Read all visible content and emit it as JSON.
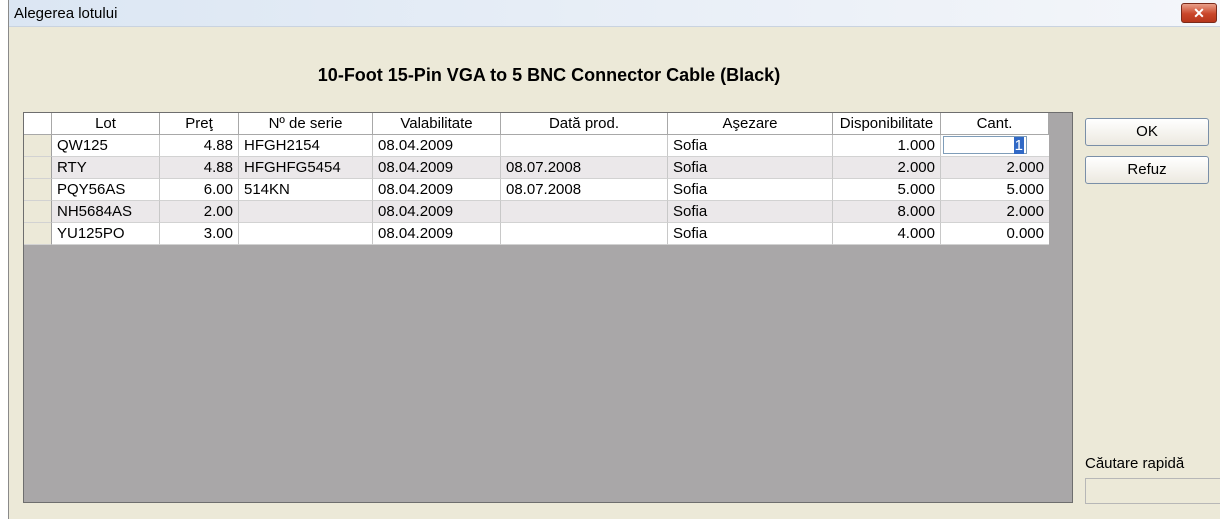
{
  "window": {
    "title": "Alegerea lotului",
    "close_symbol": "✕"
  },
  "product_title": "10-Foot 15-Pin VGA to 5 BNC Connector Cable (Black)",
  "table": {
    "columns": [
      "Lot",
      "Preţ",
      "Nº de serie",
      "Valabilitate",
      "Dată prod.",
      "Aşezare",
      "Disponibilitate",
      "Cant."
    ],
    "rows": [
      {
        "lot": "QW125",
        "pret": "4.88",
        "serie": "HFGH2154",
        "valabilitate": "08.04.2009",
        "data_prod": "",
        "asezare": "Sofia",
        "disponibilitate": "1.000",
        "cant": "1"
      },
      {
        "lot": "RTY",
        "pret": "4.88",
        "serie": "HFGHFG5454",
        "valabilitate": "08.04.2009",
        "data_prod": "08.07.2008",
        "asezare": "Sofia",
        "disponibilitate": "2.000",
        "cant": "2.000"
      },
      {
        "lot": "PQY56AS",
        "pret": "6.00",
        "serie": "514KN",
        "valabilitate": "08.04.2009",
        "data_prod": "08.07.2008",
        "asezare": "Sofia",
        "disponibilitate": "5.000",
        "cant": "5.000"
      },
      {
        "lot": "NH5684AS",
        "pret": "2.00",
        "serie": "",
        "valabilitate": "08.04.2009",
        "data_prod": "",
        "asezare": "Sofia",
        "disponibilitate": "8.000",
        "cant": "2.000"
      },
      {
        "lot": "YU125PO",
        "pret": "3.00",
        "serie": "",
        "valabilitate": "08.04.2009",
        "data_prod": "",
        "asezare": "Sofia",
        "disponibilitate": "4.000",
        "cant": "0.000"
      }
    ]
  },
  "buttons": {
    "ok": "OK",
    "cancel": "Refuz"
  },
  "quick_search": {
    "label": "Căutare rapidă",
    "value": ""
  }
}
